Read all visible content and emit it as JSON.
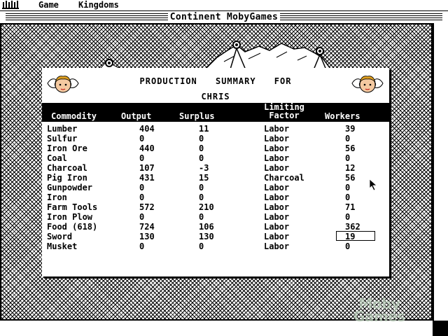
{
  "menu": {
    "icon": "castle-icon",
    "items": [
      "Game",
      "Kingdoms"
    ]
  },
  "window": {
    "title": "Continent MobyGames"
  },
  "panel": {
    "heading_line1": "PRODUCTION SUMMARY FOR",
    "heading_line2": "CHRIS",
    "decor_icons": [
      "cherub-icon",
      "cherub-icon"
    ],
    "columns": {
      "commodity": "Commodity",
      "output": "Output",
      "surplus": "Surplus",
      "limiting_1": "Limiting",
      "limiting_2": "Factor",
      "workers": "Workers"
    },
    "rows": [
      {
        "commodity": "Lumber",
        "output": "404",
        "surplus": "11",
        "limiting": "Labor",
        "workers": "39"
      },
      {
        "commodity": "Sulfur",
        "output": "0",
        "surplus": "0",
        "limiting": "Labor",
        "workers": "0"
      },
      {
        "commodity": "Iron Ore",
        "output": "440",
        "surplus": "0",
        "limiting": "Labor",
        "workers": "56"
      },
      {
        "commodity": "Coal",
        "output": "0",
        "surplus": "0",
        "limiting": "Labor",
        "workers": "0"
      },
      {
        "commodity": "Charcoal",
        "output": "107",
        "surplus": "-3",
        "limiting": "Labor",
        "workers": "12"
      },
      {
        "commodity": "Pig Iron",
        "output": "431",
        "surplus": "15",
        "limiting": "Charcoal",
        "workers": "56"
      },
      {
        "commodity": "Gunpowder",
        "output": "0",
        "surplus": "0",
        "limiting": "Labor",
        "workers": "0"
      },
      {
        "commodity": "Iron",
        "output": "0",
        "surplus": "0",
        "limiting": "Labor",
        "workers": "0"
      },
      {
        "commodity": "Farm Tools",
        "output": "572",
        "surplus": "210",
        "limiting": "Labor",
        "workers": "71"
      },
      {
        "commodity": "Iron Plow",
        "output": "0",
        "surplus": "0",
        "limiting": "Labor",
        "workers": "0"
      },
      {
        "commodity": "Food (618)",
        "output": "724",
        "surplus": "106",
        "limiting": "Labor",
        "workers": "362"
      },
      {
        "commodity": "Sword",
        "output": "130",
        "surplus": "130",
        "limiting": "Labor",
        "workers": "19",
        "selected": true
      },
      {
        "commodity": "Musket",
        "output": "0",
        "surplus": "0",
        "limiting": "Labor",
        "workers": "0"
      }
    ]
  },
  "watermark": {
    "line1": "Moby",
    "line2": "Games"
  },
  "colors": {
    "foreground": "#000000",
    "background": "#ffffff"
  }
}
